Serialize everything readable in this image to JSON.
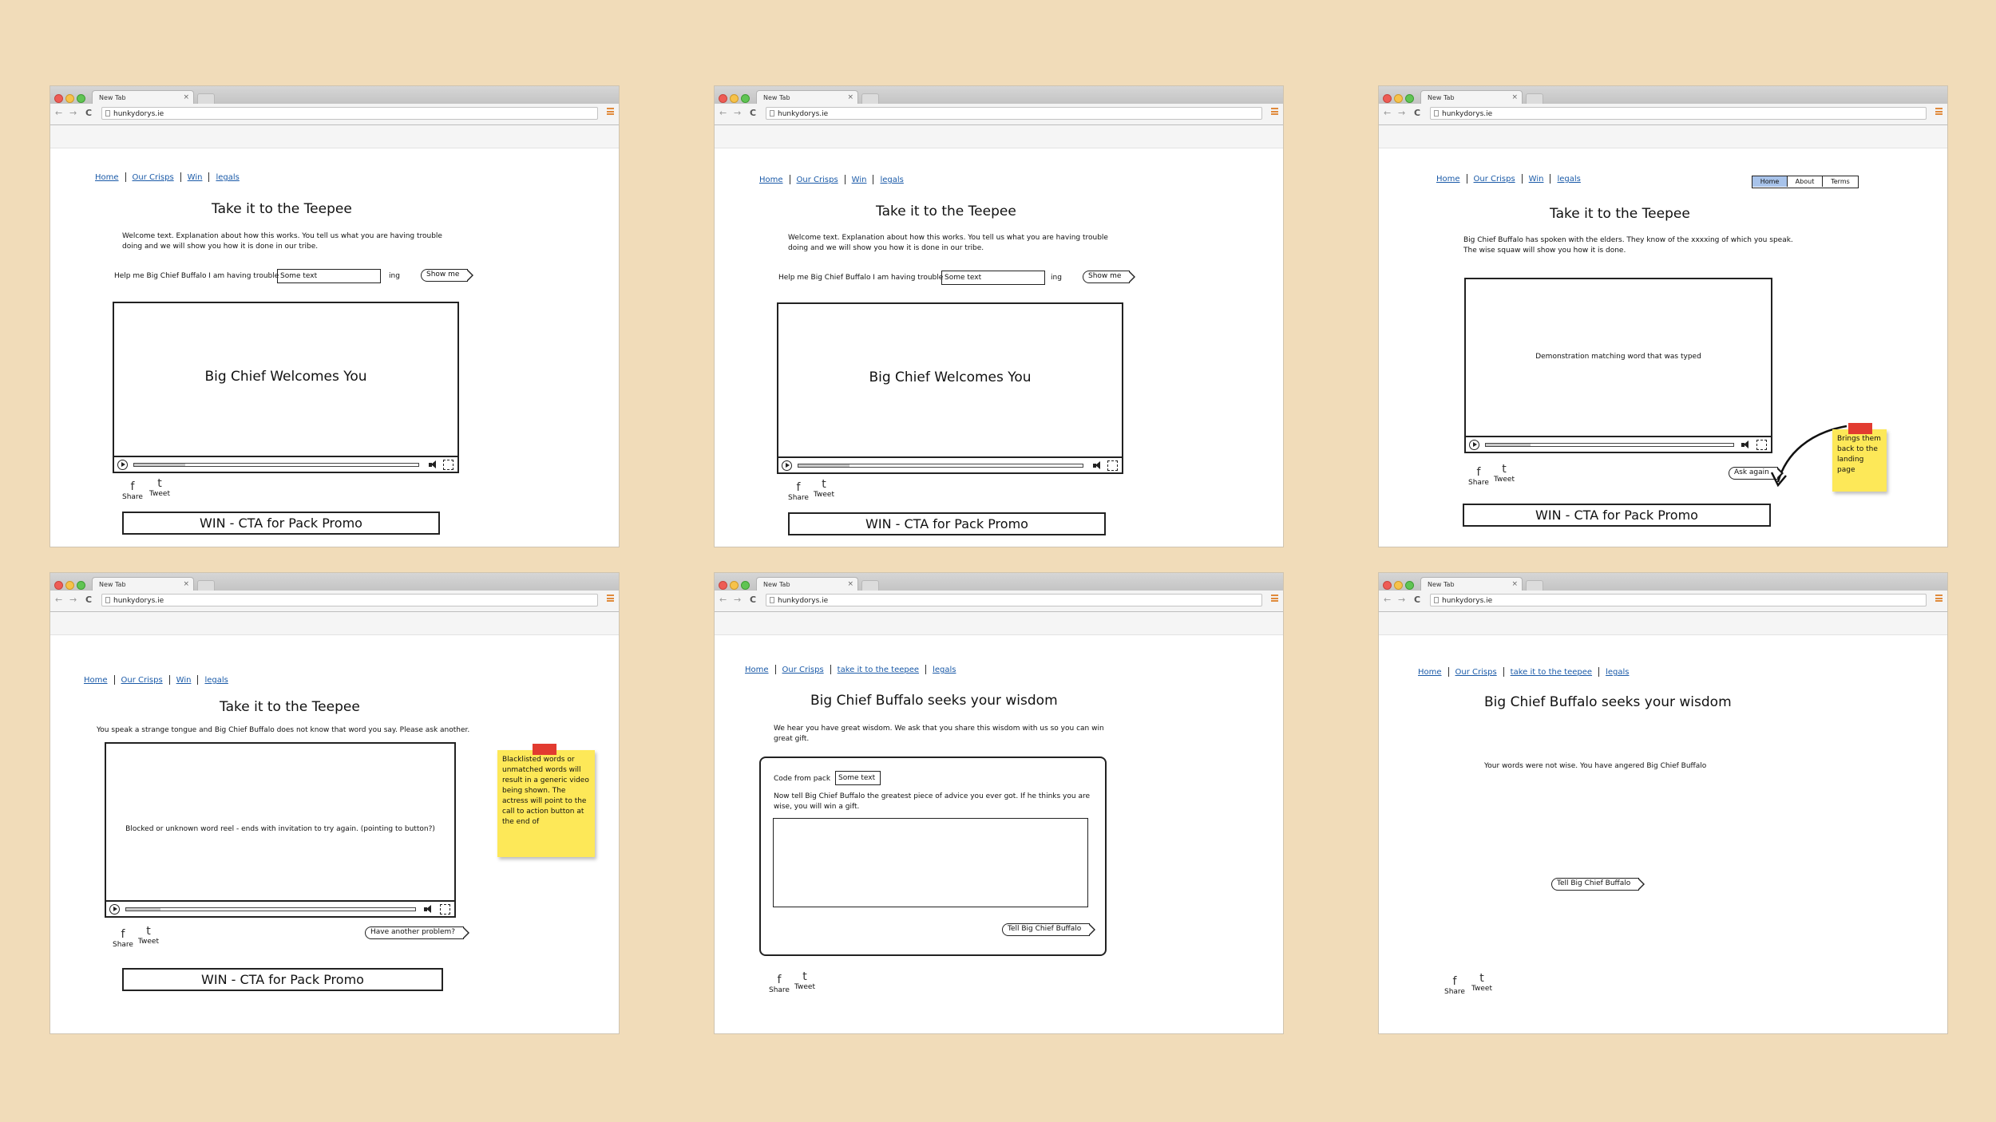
{
  "browser": {
    "tab_title": "New Tab",
    "tab_close": "×",
    "url": "hunkydorys.ie",
    "back": "←",
    "forward": "→",
    "reload": "C"
  },
  "nav1": {
    "home": "Home",
    "crisps": "Our Crisps",
    "win": "Win",
    "legals": "legals"
  },
  "nav2": {
    "home": "Home",
    "crisps": "Our Crisps",
    "teepee": "take it to the teepee",
    "legals": "legals"
  },
  "title_teepee": "Take it to the Teepee",
  "title_wisdom": "Big Chief Buffalo seeks your wisdom",
  "welcome_text": "Welcome text.  Explanation about how this works.  You tell us what you are having trouble doing and we will show you how it is done in our tribe.",
  "help_label": "Help me Big Chief Buffalo I am having trouble",
  "input_value": "Some text",
  "ing_suffix": "ing",
  "show_me": "Show me",
  "video_welcome": "Big Chief Welcomes You",
  "share": "Share",
  "tweet": "Tweet",
  "share_icon": "f",
  "tweet_icon": "t",
  "cta": "WIN - CTA for Pack Promo",
  "screen3": {
    "tabs": [
      "Home",
      "About",
      "Terms"
    ],
    "text": "Big Chief Buffalo has spoken with the elders. They know of the xxxxing of which you speak. The wise squaw will show you how it is done.",
    "video": "Demonstration matching word that was typed",
    "ask_again": "Ask again",
    "note": "Brings them back to the landing page"
  },
  "screen4": {
    "text": "You speak a strange tongue and Big Chief Buffalo does not know that word you say.  Please ask another.",
    "video": "Blocked or unknown word reel - ends with invitation to try again. (pointing to button?)",
    "another": "Have another problem?",
    "note": "Blacklisted words or unmatched words will result in a generic video being shown. The actress will point to the call to action button at the end of"
  },
  "screen5": {
    "text": "We hear you have great wisdom.  We ask that you share this wisdom with us so you can win great gift.",
    "code_label": "Code from pack",
    "code_value": "Some text",
    "advice": "Now tell Big Chief Buffalo the greatest piece of advice you ever got.  If he thinks you are wise, you will win a gift.",
    "button": "Tell Big Chief Buffalo"
  },
  "screen6": {
    "text": "Your words were not wise.  You have angered Big Chief Buffalo",
    "button": "Tell Big Chief Buffalo"
  },
  "colors": {
    "background": "#f1dcb9",
    "note": "#fde858",
    "pin": "#e23b30",
    "link": "#1a5aa8",
    "selected_tab": "#a8c3ea"
  }
}
